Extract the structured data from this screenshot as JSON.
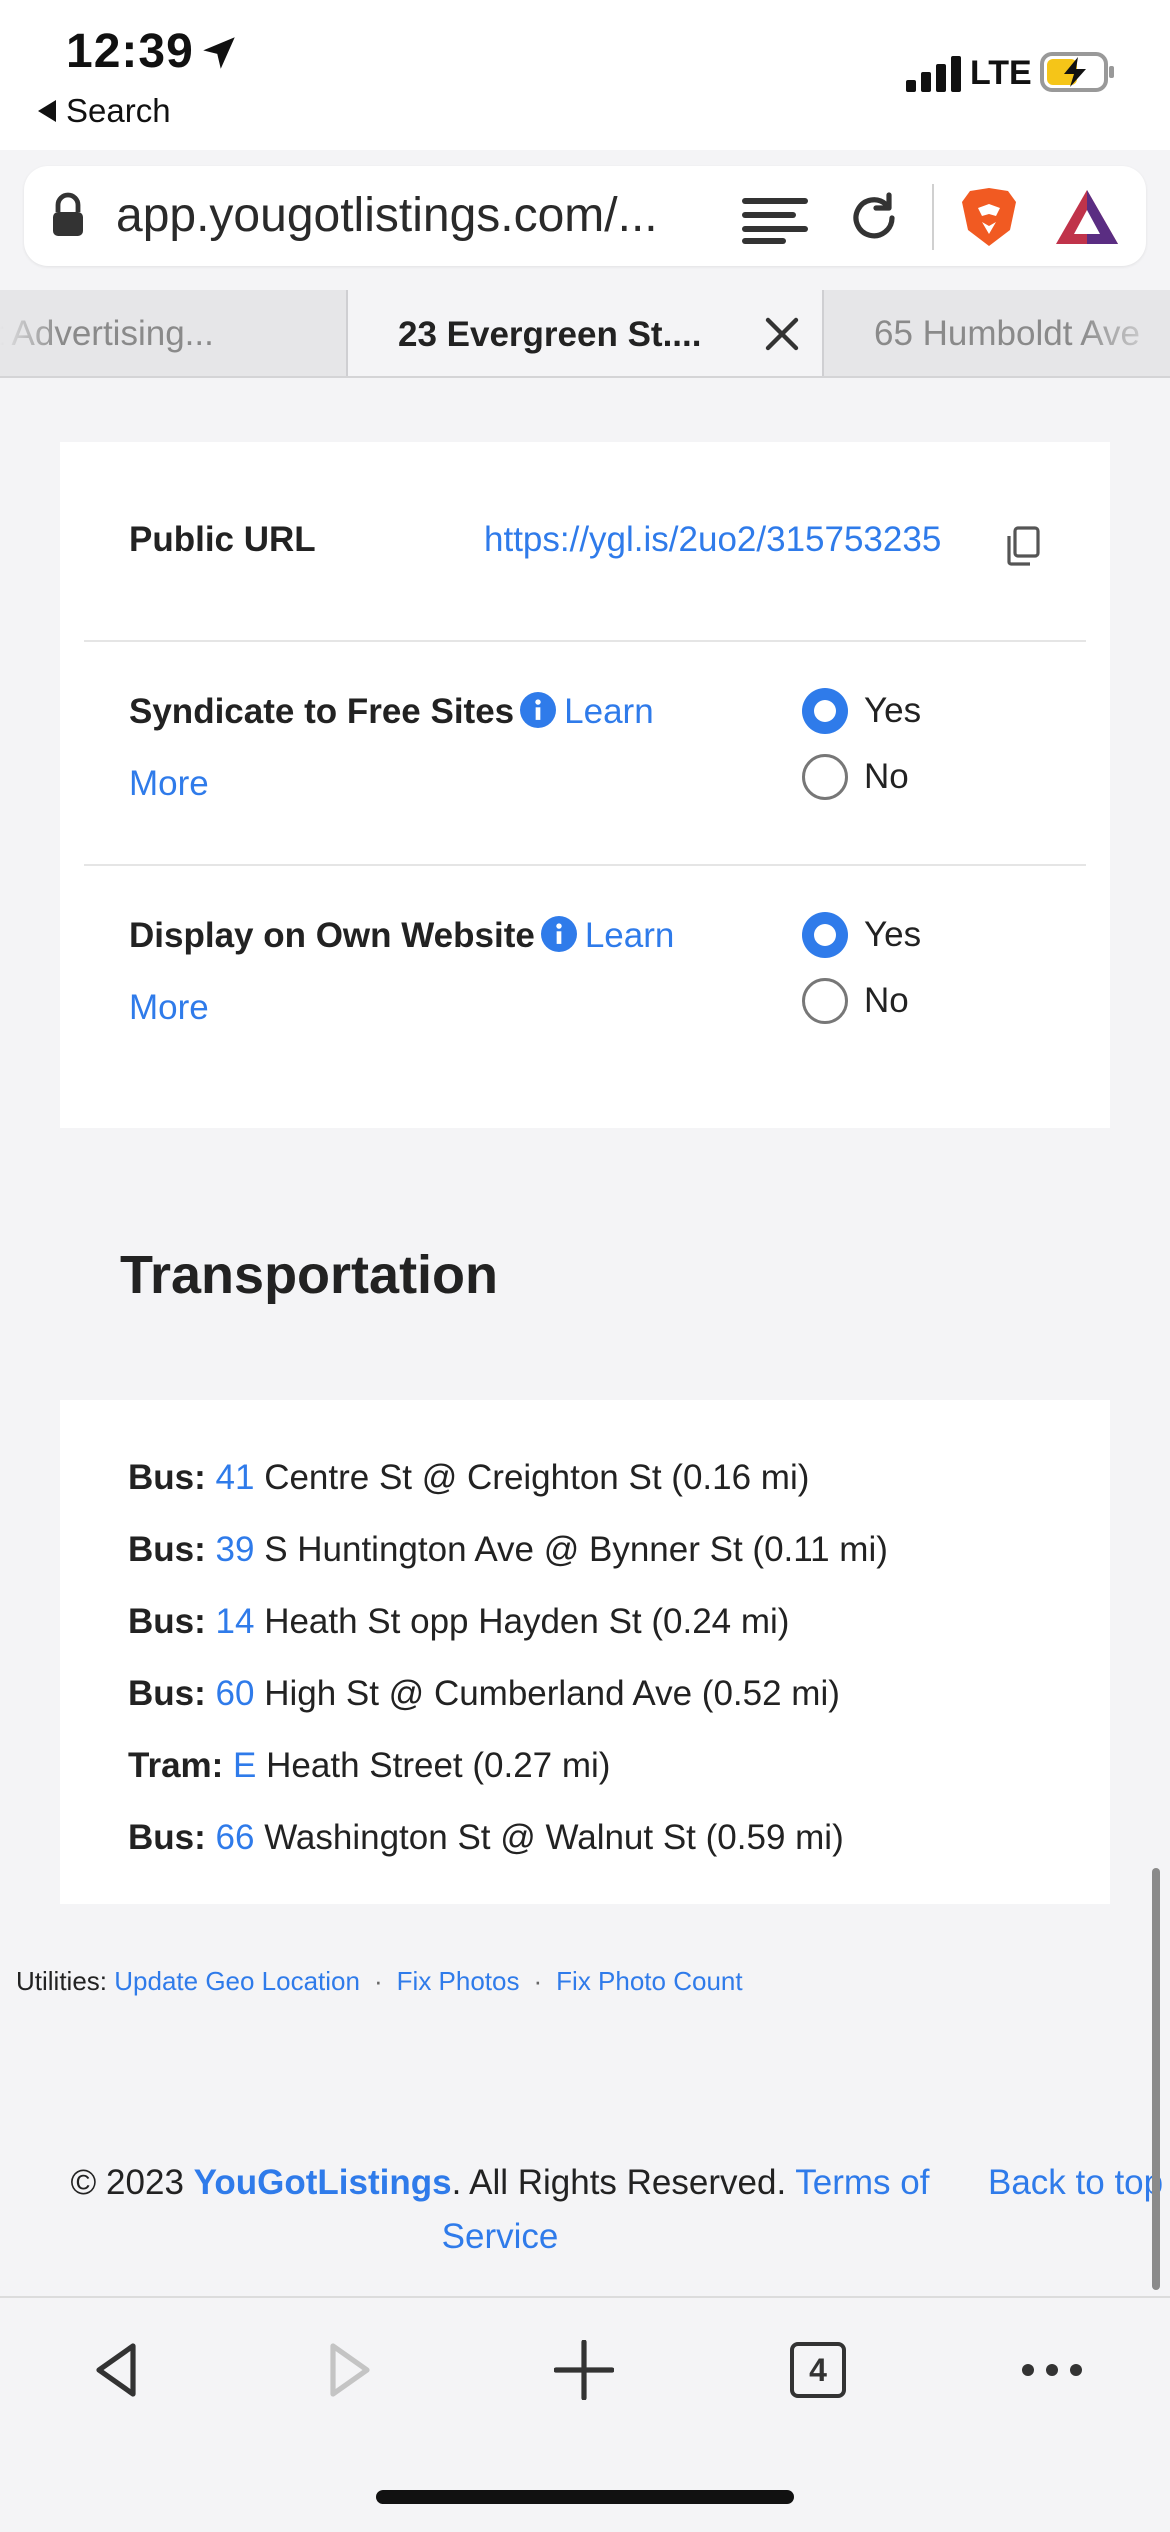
{
  "status": {
    "time": "12:39",
    "back_label": "Search",
    "network": "LTE"
  },
  "browser": {
    "url": "app.yougotlistings.com/...",
    "tabs": [
      {
        "label": "t Advertising..."
      },
      {
        "label": "23 Evergreen St...."
      },
      {
        "label": "65 Humboldt Ave"
      }
    ],
    "tab_count": "4"
  },
  "settings": {
    "public_url": {
      "label": "Public URL",
      "value": "https://ygl.is/2uo2/315753235"
    },
    "syndicate": {
      "label": "Syndicate to Free Sites",
      "learn": "Learn",
      "more": "More",
      "yes": "Yes",
      "no": "No",
      "selected": "Yes"
    },
    "display": {
      "label": "Display on Own Website",
      "learn": "Learn",
      "more": "More",
      "yes": "Yes",
      "no": "No",
      "selected": "Yes"
    }
  },
  "transportation": {
    "title": "Transportation",
    "items": [
      {
        "mode": "Bus:",
        "route": "41",
        "desc": "Centre St @ Creighton St (0.16 mi)"
      },
      {
        "mode": "Bus:",
        "route": "39",
        "desc": "S Huntington Ave @ Bynner St (0.11 mi)"
      },
      {
        "mode": "Bus:",
        "route": "14",
        "desc": "Heath St opp Hayden St (0.24 mi)"
      },
      {
        "mode": "Bus:",
        "route": "60",
        "desc": "High St @ Cumberland Ave (0.52 mi)"
      },
      {
        "mode": "Tram:",
        "route": "E",
        "desc": "Heath Street (0.27 mi)"
      },
      {
        "mode": "Bus:",
        "route": "66",
        "desc": "Washington St @ Walnut St (0.59 mi)"
      }
    ]
  },
  "footer": {
    "utilities_label": "Utilities:",
    "utilities": [
      "Update Geo Location",
      "Fix Photos",
      "Fix Photo Count"
    ],
    "separator": "·",
    "copyright_prefix": "© 2023",
    "brand": "YouGotListings",
    "rights": ". All Rights Reserved.",
    "terms": "Terms of Service",
    "back_to_top": "Back to top"
  },
  "colors": {
    "accent": "#2f7bea",
    "brave_orange": "#f15a22",
    "battery_yellow": "#f5c518"
  }
}
